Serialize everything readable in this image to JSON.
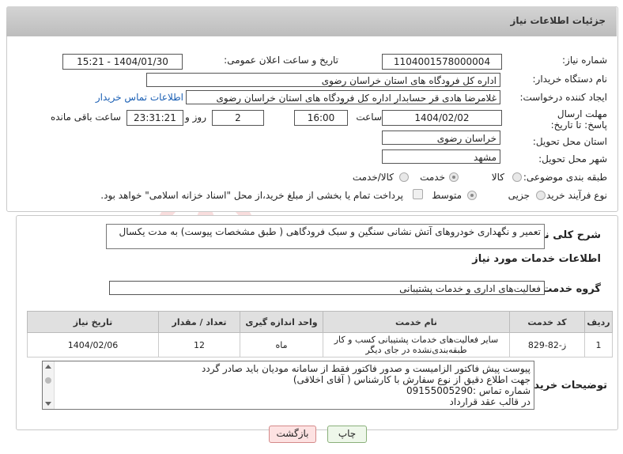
{
  "header": {
    "title": "جزئیات اطلاعات نیاز"
  },
  "form": {
    "need_number_label": "شماره نیاز:",
    "need_number": "1104001578000004",
    "announce_label": "تاریخ و ساعت اعلان عمومی:",
    "announce_value": "1404/01/30 - 15:21",
    "buyer_org_label": "نام دستگاه خریدار:",
    "buyer_org": "اداره کل فرودگاه های استان خراسان رضوی",
    "creator_label": "ایجاد کننده درخواست:",
    "creator": "غلامرضا هادی قر حسابدار اداره کل فرودگاه های استان خراسان رضوی",
    "contact_link": "اطلاعات تماس خریدار",
    "deadline_label": "مهلت ارسال پاسخ: تا تاریخ:",
    "deadline_date": "1404/02/02",
    "time_label": "ساعت",
    "deadline_time": "16:00",
    "days_value": "2",
    "days_label": "روز و",
    "remaining_time": "23:31:21",
    "remaining_label": "ساعت باقی مانده",
    "province_label": "استان محل تحویل:",
    "province": "خراسان رضوی",
    "city_label": "شهر محل تحویل:",
    "city": "مشهد",
    "category_label": "طبقه بندی موضوعی:",
    "category_options": [
      "کالا",
      "خدمت",
      "کالا/خدمت"
    ],
    "category_selected": "خدمت",
    "process_label": "نوع فرآیند خرید :",
    "process_options": [
      "جزیی",
      "متوسط"
    ],
    "process_selected": "متوسط",
    "payment_note": "پرداخت تمام یا بخشی از مبلغ خرید،از محل \"اسناد خزانه اسلامی\" خواهد بود."
  },
  "description": {
    "label": "شرح کلی نیاز:",
    "text": "تعمیر و نگهداری خودروهای آتش نشانی سنگین و سبک فرودگاهی ( طبق مشخصات پیوست) به مدت یکسال"
  },
  "services": {
    "section_title": "اطلاعات خدمات مورد نیاز",
    "group_label": "گروه خدمت:",
    "group_value": "فعالیت‌های اداری و خدمات پشتیبانی",
    "columns": [
      "ردیف",
      "کد خدمت",
      "نام خدمت",
      "واحد اندازه گیری",
      "تعداد / مقدار",
      "تاریخ نیاز"
    ],
    "rows": [
      {
        "row": "1",
        "code": "ز-82-829",
        "name": "سایر فعالیت‌های خدمات پشتیبانی کسب و کار طبقه‌بندی‌نشده در جای دیگر",
        "unit": "ماه",
        "qty": "12",
        "date": "1404/02/06"
      }
    ]
  },
  "buyer_notes": {
    "label": "توضیحات خریدار:",
    "lines": [
      "پیوست پیش فاکتور الزامیست و صدور فاکتور فقط از سامانه مودیان باید صادر گردد",
      "جهت اطلاع دقیق از نوع سفارش با کارشناس  ( آقای اخلاقی)",
      "شماره تماس :09155005290",
      "در قالب عقد قرارداد"
    ]
  },
  "buttons": {
    "print": "چاپ",
    "back": "بازگشت"
  },
  "colors": {
    "header_bg": "#c8c8c8",
    "link": "#1a5fb4",
    "back_button": "#fde2e2",
    "print_button": "#e6f4e0"
  }
}
